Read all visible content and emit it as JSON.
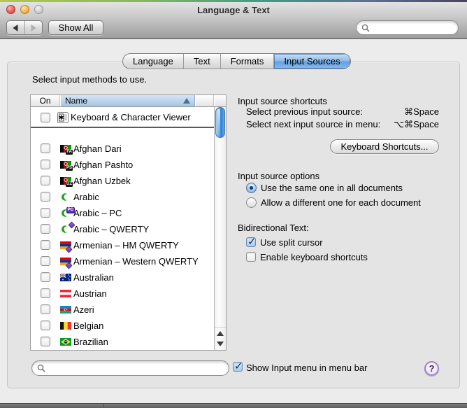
{
  "window": {
    "title": "Language & Text"
  },
  "toolbar": {
    "back_button": "back",
    "forward_button": "forward",
    "show_all_label": "Show All",
    "search_placeholder": ""
  },
  "tabs": [
    {
      "label": "Language",
      "selected": false
    },
    {
      "label": "Text",
      "selected": false
    },
    {
      "label": "Formats",
      "selected": false
    },
    {
      "label": "Input Sources",
      "selected": true
    }
  ],
  "main": {
    "instruction": "Select input methods to use.",
    "table": {
      "columns": [
        {
          "label": "On"
        },
        {
          "label": "Name",
          "sorted": "ascending"
        }
      ],
      "special_row": {
        "label": "Keyboard & Character Viewer",
        "checked": false,
        "icon": "keyboard-character-viewer-icon"
      },
      "rows": [
        {
          "label": "Afghan Dari",
          "flag": "afghanistan",
          "badge": "FA",
          "checked": false
        },
        {
          "label": "Afghan Pashto",
          "flag": "afghanistan",
          "badge": "PS",
          "checked": false
        },
        {
          "label": "Afghan Uzbek",
          "flag": "afghanistan",
          "badge": "UZ",
          "checked": false
        },
        {
          "label": "Arabic",
          "flag": "crescent",
          "badge": "",
          "checked": false
        },
        {
          "label": "Arabic – PC",
          "flag": "crescent",
          "badge": "PC",
          "checked": false
        },
        {
          "label": "Arabic – QWERTY",
          "flag": "crescent",
          "badge": "diamond",
          "checked": false
        },
        {
          "label": "Armenian – HM QWERTY",
          "flag": "armenia",
          "badge": "diamond",
          "checked": false
        },
        {
          "label": "Armenian – Western QWERTY",
          "flag": "armenia",
          "badge": "diamond",
          "checked": false
        },
        {
          "label": "Australian",
          "flag": "australia",
          "badge": "",
          "checked": false
        },
        {
          "label": "Austrian",
          "flag": "austria",
          "badge": "",
          "checked": false
        },
        {
          "label": "Azeri",
          "flag": "azerbaijan",
          "badge": "",
          "checked": false
        },
        {
          "label": "Belgian",
          "flag": "belgium",
          "badge": "",
          "checked": false
        },
        {
          "label": "Brazilian",
          "flag": "brazil",
          "badge": "",
          "checked": false
        }
      ]
    },
    "shortcuts": {
      "title": "Input source shortcuts",
      "rows": [
        {
          "label": "Select previous input source:",
          "value": "⌘Space"
        },
        {
          "label": "Select next input source in menu:",
          "value": "⌥⌘Space"
        }
      ],
      "button_label": "Keyboard Shortcuts..."
    },
    "options": {
      "title": "Input source options",
      "radios": [
        {
          "label": "Use the same one in all documents",
          "selected": true
        },
        {
          "label": "Allow a different one for each document",
          "selected": false
        }
      ]
    },
    "bidi": {
      "title": "Bidirectional Text:",
      "checkboxes": [
        {
          "label": "Use split cursor",
          "checked": true
        },
        {
          "label": "Enable keyboard shortcuts",
          "checked": false
        }
      ]
    },
    "footer": {
      "search_placeholder": "",
      "show_input_menu_label": "Show Input menu in menu bar",
      "show_input_menu_checked": true,
      "help_label": "?"
    }
  },
  "colors": {
    "selected_tab_blue": "#639fdf",
    "table_header_blue": "#a6c5e2",
    "scroll_thumb_blue": "#2f7fd3",
    "help_ring_purple": "#9c85c6",
    "badge_purple": "#5b2fb4"
  }
}
